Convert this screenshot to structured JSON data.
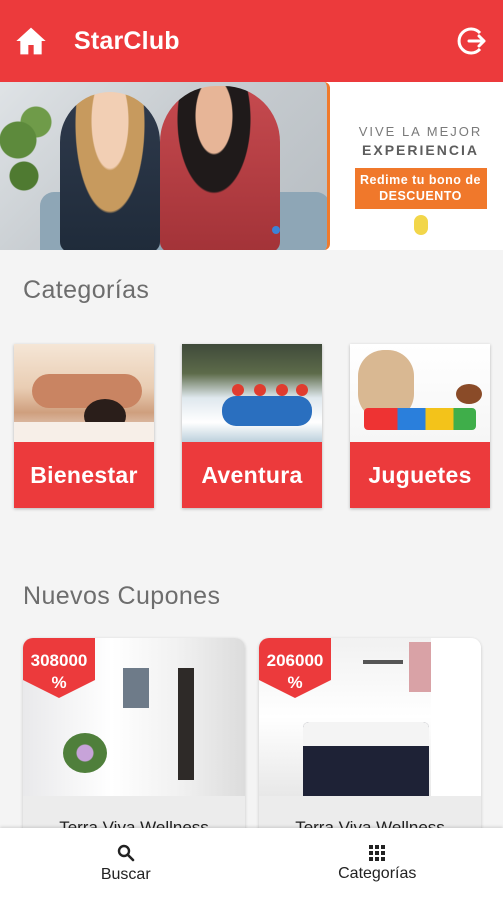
{
  "appbar": {
    "title": "StarClub",
    "icons": {
      "home": "home-icon",
      "logout": "logout-icon"
    }
  },
  "banner": {
    "promo_line1": "VIVE LA MEJOR",
    "promo_line2": "EXPERIENCIA",
    "promo_button": "Redime tu bono de DESCUENTO",
    "promo_color": "#f0782b"
  },
  "sections": {
    "categories_title": "Categorías",
    "coupons_title": "Nuevos Cupones"
  },
  "categories": [
    {
      "label": "Bienestar"
    },
    {
      "label": "Aventura"
    },
    {
      "label": "Juguetes"
    }
  ],
  "coupons": [
    {
      "discount": "308000",
      "pct": "%",
      "name": "Terra Viva Wellness"
    },
    {
      "discount": "206000",
      "pct": "%",
      "name": "Terra Viva Wellness"
    }
  ],
  "bottom_nav": [
    {
      "label": "Buscar",
      "icon": "search-icon"
    },
    {
      "label": "Categorías",
      "icon": "grid-icon"
    }
  ],
  "colors": {
    "primary": "#ec3a3c",
    "accent": "#f0782b",
    "text_muted": "#6d6d6d"
  }
}
